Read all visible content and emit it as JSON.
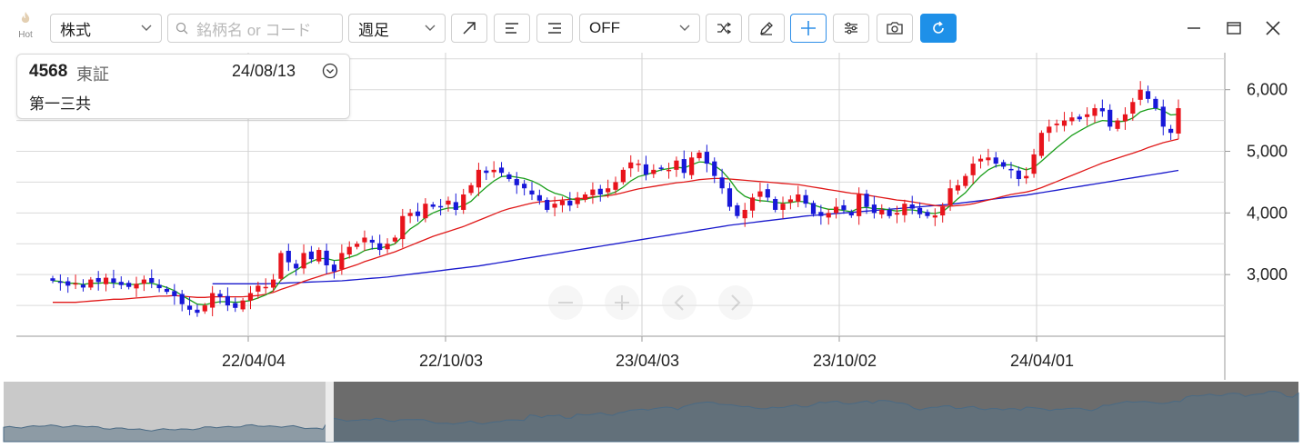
{
  "toolbar": {
    "hot_label": "Hot",
    "market_type": "株式",
    "search_placeholder": "銘柄名 or コード",
    "period": "週足",
    "indicator": "OFF"
  },
  "quote": {
    "code": "4568",
    "market": "東証",
    "date": "24/08/13",
    "name": "第一三共"
  },
  "chart_data": {
    "type": "candlestick",
    "y_ticks": [
      "6,000",
      "5,000",
      "4,000",
      "3,000"
    ],
    "x_ticks": [
      "22/04/04",
      "22/10/03",
      "23/04/03",
      "23/10/02",
      "24/04/01"
    ],
    "ylim": [
      2000,
      6600
    ],
    "grid": true,
    "up_color": "#e8141c",
    "down_color": "#1818d8",
    "ma_colors": [
      "#1a9e1a",
      "#e01818",
      "#1818cc"
    ],
    "series_close": [
      2900,
      2880,
      2820,
      2860,
      2790,
      2920,
      2880,
      2950,
      2870,
      2830,
      2800,
      2850,
      2920,
      2870,
      2780,
      2720,
      2650,
      2520,
      2430,
      2380,
      2500,
      2700,
      2640,
      2500,
      2460,
      2580,
      2700,
      2820,
      2800,
      2920,
      3350,
      3200,
      3100,
      3350,
      3250,
      3400,
      3150,
      3050,
      3350,
      3450,
      3500,
      3600,
      3520,
      3400,
      3500,
      3600,
      3950,
      4000,
      3950,
      4150,
      4100,
      4100,
      4200,
      4050,
      4300,
      4450,
      4700,
      4650,
      4700,
      4650,
      4550,
      4450,
      4400,
      4300,
      4200,
      4050,
      4150,
      4200,
      4120,
      4250,
      4300,
      4380,
      4300,
      4400,
      4500,
      4700,
      4820,
      4800,
      4620,
      4700,
      4720,
      4700,
      4850,
      4650,
      4900,
      4980,
      4800,
      4600,
      4400,
      4100,
      3950,
      4050,
      4250,
      4350,
      4250,
      4050,
      4150,
      4220,
      4300,
      4150,
      3980,
      3950,
      4000,
      4100,
      4050,
      3960,
      4300,
      4100,
      4000,
      4050,
      3950,
      4000,
      4150,
      4070,
      3980,
      3950,
      3960,
      4100,
      4400,
      4450,
      4600,
      4800,
      4880,
      4900,
      4800,
      4750,
      4700,
      4550,
      4600,
      4950,
      5300,
      5400,
      5450,
      5500,
      5550,
      5520,
      5600,
      5700,
      5650,
      5400,
      5500,
      5600,
      5800,
      6000,
      5850,
      5700,
      5400,
      5300,
      5700
    ],
    "ma_short": [
      2900,
      2890,
      2860,
      2860,
      2840,
      2860,
      2860,
      2870,
      2860,
      2850,
      2840,
      2840,
      2860,
      2860,
      2830,
      2790,
      2740,
      2660,
      2590,
      2520,
      2510,
      2540,
      2560,
      2560,
      2550,
      2560,
      2580,
      2620,
      2670,
      2740,
      2910,
      3000,
      3070,
      3150,
      3210,
      3260,
      3260,
      3230,
      3240,
      3280,
      3320,
      3390,
      3420,
      3430,
      3460,
      3500,
      3620,
      3740,
      3820,
      3930,
      4000,
      4050,
      4080,
      4080,
      4120,
      4190,
      4310,
      4420,
      4520,
      4590,
      4600,
      4580,
      4560,
      4520,
      4460,
      4380,
      4320,
      4290,
      4230,
      4210,
      4220,
      4250,
      4270,
      4300,
      4340,
      4420,
      4520,
      4590,
      4620,
      4660,
      4700,
      4720,
      4740,
      4730,
      4780,
      4830,
      4820,
      4770,
      4680,
      4540,
      4370,
      4270,
      4220,
      4200,
      4190,
      4170,
      4160,
      4170,
      4190,
      4180,
      4130,
      4090,
      4060,
      4060,
      4040,
      4020,
      4080,
      4090,
      4070,
      4070,
      4050,
      4030,
      4050,
      4050,
      4030,
      4000,
      3990,
      4020,
      4120,
      4230,
      4330,
      4470,
      4600,
      4700,
      4760,
      4780,
      4780,
      4740,
      4700,
      4740,
      4840,
      4950,
      5060,
      5160,
      5260,
      5330,
      5400,
      5460,
      5500,
      5490,
      5480,
      5490,
      5540,
      5640,
      5680,
      5700,
      5660,
      5590,
      5600
    ],
    "ma_mid": [
      2550,
      2550,
      2550,
      2550,
      2560,
      2570,
      2580,
      2590,
      2600,
      2600,
      2610,
      2620,
      2630,
      2640,
      2650,
      2650,
      2660,
      2650,
      2640,
      2630,
      2630,
      2640,
      2640,
      2640,
      2640,
      2640,
      2650,
      2660,
      2680,
      2710,
      2760,
      2800,
      2840,
      2890,
      2930,
      2970,
      3010,
      3040,
      3080,
      3120,
      3160,
      3210,
      3250,
      3290,
      3330,
      3370,
      3420,
      3470,
      3520,
      3570,
      3620,
      3660,
      3700,
      3740,
      3780,
      3830,
      3880,
      3930,
      3980,
      4030,
      4070,
      4100,
      4130,
      4160,
      4180,
      4190,
      4200,
      4210,
      4220,
      4230,
      4240,
      4260,
      4270,
      4280,
      4300,
      4330,
      4360,
      4390,
      4410,
      4430,
      4450,
      4470,
      4490,
      4500,
      4520,
      4540,
      4550,
      4560,
      4560,
      4550,
      4540,
      4530,
      4520,
      4510,
      4500,
      4490,
      4480,
      4470,
      4460,
      4440,
      4420,
      4400,
      4380,
      4360,
      4340,
      4320,
      4310,
      4290,
      4270,
      4250,
      4230,
      4210,
      4200,
      4180,
      4160,
      4140,
      4120,
      4110,
      4110,
      4120,
      4130,
      4150,
      4180,
      4210,
      4240,
      4270,
      4300,
      4320,
      4340,
      4370,
      4410,
      4460,
      4510,
      4560,
      4610,
      4660,
      4710,
      4760,
      4810,
      4850,
      4890,
      4930,
      4970,
      5010,
      5060,
      5100,
      5140,
      5170,
      5200
    ],
    "ma_long": [
      null,
      null,
      null,
      null,
      null,
      null,
      null,
      null,
      null,
      null,
      null,
      null,
      null,
      null,
      null,
      null,
      null,
      null,
      null,
      null,
      null,
      2850,
      2850,
      2850,
      2850,
      2850,
      2850,
      2850,
      2850,
      2855,
      2860,
      2865,
      2870,
      2875,
      2880,
      2885,
      2890,
      2895,
      2900,
      2910,
      2920,
      2930,
      2940,
      2950,
      2960,
      2975,
      2990,
      3005,
      3020,
      3035,
      3050,
      3065,
      3080,
      3095,
      3110,
      3125,
      3140,
      3160,
      3180,
      3200,
      3220,
      3240,
      3260,
      3280,
      3300,
      3320,
      3340,
      3360,
      3380,
      3400,
      3420,
      3440,
      3460,
      3480,
      3500,
      3520,
      3540,
      3560,
      3580,
      3600,
      3620,
      3640,
      3660,
      3680,
      3700,
      3720,
      3740,
      3760,
      3780,
      3800,
      3815,
      3830,
      3845,
      3860,
      3875,
      3890,
      3905,
      3920,
      3935,
      3950,
      3960,
      3970,
      3980,
      3990,
      4000,
      4010,
      4020,
      4030,
      4040,
      4050,
      4060,
      4070,
      4080,
      4090,
      4100,
      4110,
      4120,
      4130,
      4140,
      4155,
      4170,
      4185,
      4200,
      4215,
      4230,
      4245,
      4260,
      4275,
      4290,
      4310,
      4330,
      4350,
      4370,
      4390,
      4410,
      4430,
      4450,
      4470,
      4490,
      4510,
      4530,
      4550,
      4570,
      4590,
      4610,
      4630,
      4650,
      4670,
      4690
    ]
  }
}
